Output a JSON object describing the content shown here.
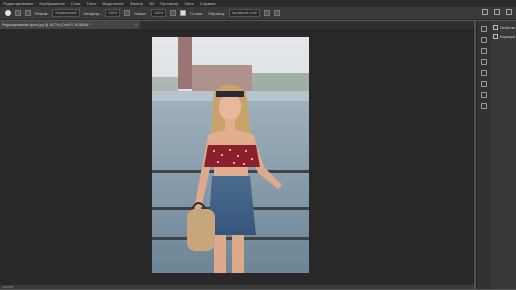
{
  "menu": [
    "Редактирование",
    "Изображение",
    "Слои",
    "Текст",
    "Выделение",
    "Фильтр",
    "3D",
    "Просмотр",
    "Окно",
    "Справка"
  ],
  "options": {
    "mode_label": "Режим:",
    "mode_value": "Нормальный",
    "opacity_label": "Непрозр.:",
    "opacity_value": "100%",
    "flow_label": "Нажм.:",
    "flow_value": "100%",
    "smoothing_label": "Сглаж.:",
    "smoothing_value": "",
    "sample_label": "Образец:",
    "sample_value": "Активный слой"
  },
  "document": {
    "tab_title": "Редактирование-фото.jpg @ 16,7% (Слой 0, RGB/8#) *",
    "close": "×"
  },
  "status": "16,67%",
  "panel": {
    "items": [
      "Свойства",
      "Корекция"
    ]
  }
}
